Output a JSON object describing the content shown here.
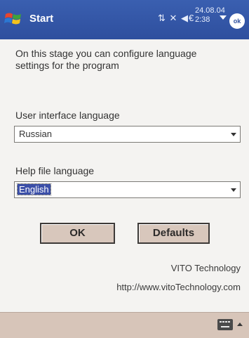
{
  "titlebar": {
    "title": "Start",
    "date": "24.08.04",
    "time": "2:38",
    "ok_label": "ok",
    "status_icons": "⇅ ✕ ◀€"
  },
  "content": {
    "intro": "On this stage you can configure language settings for the program",
    "ui_language": {
      "label": "User interface language",
      "value": "Russian"
    },
    "help_language": {
      "label": "Help file language",
      "value": "English"
    }
  },
  "buttons": {
    "ok": "OK",
    "defaults": "Defaults"
  },
  "vendor": {
    "name": "VITO Technology",
    "url": "http://www.vitoTechnology.com"
  },
  "colors": {
    "titlebar": "#2e4f9e",
    "highlight": "#3b4fa8",
    "button_face": "#d8c7bc",
    "bottombar": "#d7c5b9"
  },
  "icons": {
    "start": "windows-flag-icon",
    "keyboard": "keyboard-icon"
  }
}
